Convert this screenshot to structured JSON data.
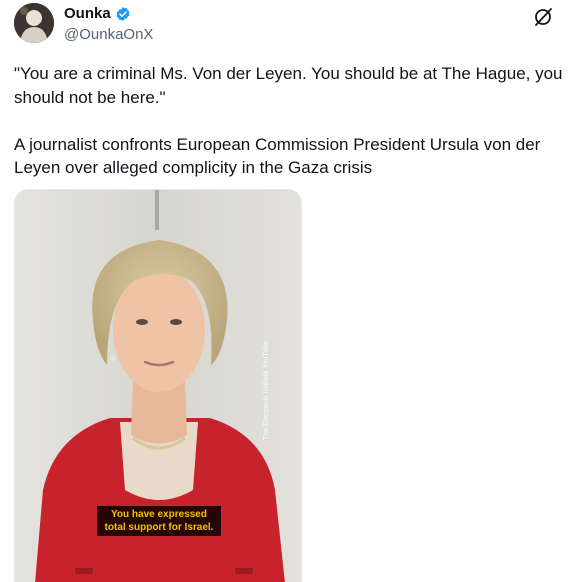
{
  "author": {
    "display_name": "Ounka",
    "handle": "@OunkaOnX",
    "avatar_icon": "avatar-image",
    "verified_icon": "verified-badge-icon"
  },
  "actions": {
    "grok_icon": "grok-icon",
    "more_icon": "more-options-icon"
  },
  "tweet": {
    "text": "\"You are a criminal Ms. Von der Leyen. You should be at The Hague, you should not be here.\"\n\nA journalist confronts European Commission President Ursula von der Leyen over alleged complicity in the Gaza crisis"
  },
  "media": {
    "caption": "You have expressed total support for Israel.",
    "watermark": "The Electronic Intifada YouTube"
  },
  "colors": {
    "verified_blue": "#1d9bf0",
    "text_primary": "#0f1419",
    "text_secondary": "#536471",
    "caption_yellow": "#f6c000",
    "jacket_red": "#c8232c"
  }
}
